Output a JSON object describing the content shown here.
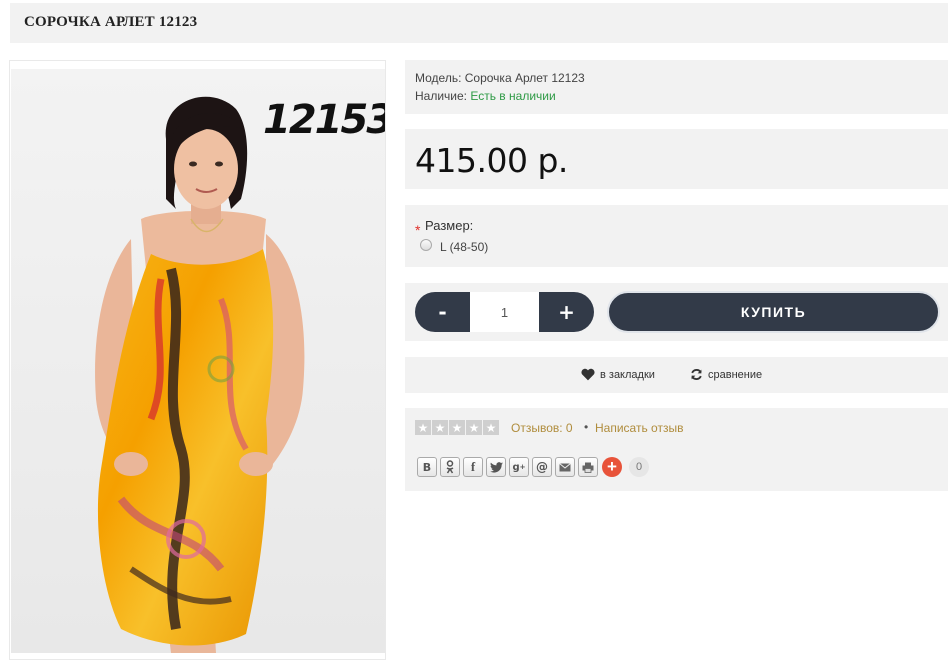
{
  "page": {
    "title": "СОРОЧКА АРЛЕТ 12123"
  },
  "product_image": {
    "number_text": "12153"
  },
  "info": {
    "model_label": "Модель:",
    "model_value": "Сорочка Арлет 12123",
    "stock_label": "Наличие:",
    "stock_value": "Есть в наличии",
    "stock_color": "#2e9a45"
  },
  "price": "415.00 р.",
  "option": {
    "required_mark": "*",
    "label": "Размер:",
    "choice": "L (48-50)"
  },
  "cart": {
    "minus_label": "-",
    "quantity": "1",
    "plus_label": "+",
    "buy_label": "КУПИТЬ",
    "button_color": "#323a48"
  },
  "links": {
    "wishlist": "в закладки",
    "compare": "сравнение"
  },
  "reviews": {
    "rating": 0,
    "max_rating": 5,
    "count_text": "Отзывов: 0",
    "separator": "•",
    "write_text": "Написать отзыв",
    "link_color": "#b08d3d"
  },
  "share": {
    "buttons": [
      {
        "glyph": "В",
        "icon": "vk-icon"
      },
      {
        "glyph": "ok",
        "icon": "odnoklassniki-icon"
      },
      {
        "glyph": "f",
        "icon": "facebook-icon"
      },
      {
        "glyph": "tw",
        "icon": "twitter-icon"
      },
      {
        "glyph": "g+",
        "icon": "google-plus-icon"
      },
      {
        "glyph": "@",
        "icon": "mail-ru-icon"
      },
      {
        "glyph": "✉",
        "icon": "email-icon"
      },
      {
        "glyph": "⎙",
        "icon": "print-icon"
      }
    ],
    "more_label": "+",
    "count": "0"
  }
}
